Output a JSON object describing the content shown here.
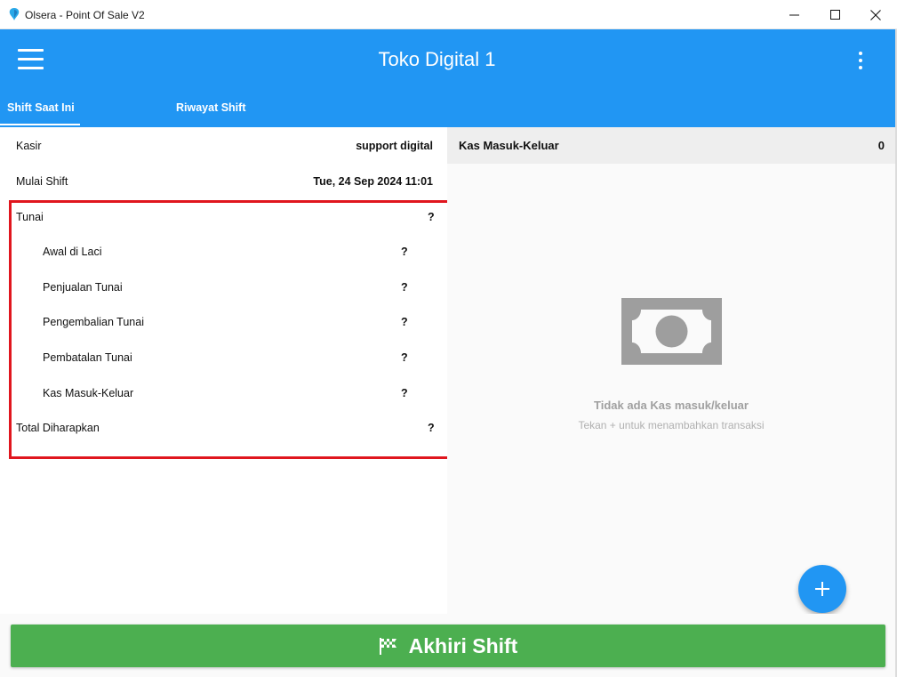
{
  "window": {
    "title": "Olsera - Point Of Sale V2"
  },
  "appbar": {
    "title": "Toko Digital 1",
    "color": "#2196f3"
  },
  "tabs": [
    {
      "label": "Shift Saat Ini",
      "active": true
    },
    {
      "label": "Riwayat Shift",
      "active": false
    }
  ],
  "shift": {
    "cashier_label": "Kasir",
    "cashier_value": "support digital",
    "start_label": "Mulai Shift",
    "start_value": "Tue, 24 Sep 2024 11:01",
    "cash_label": "Tunai",
    "cash_value": "?",
    "details": [
      {
        "label": "Awal di Laci",
        "value": "?"
      },
      {
        "label": "Penjualan Tunai",
        "value": "?"
      },
      {
        "label": "Pengembalian Tunai",
        "value": "?"
      },
      {
        "label": "Pembatalan Tunai",
        "value": "?"
      },
      {
        "label": "Kas Masuk-Keluar",
        "value": "?"
      }
    ],
    "total_label": "Total Diharapkan",
    "total_value": "?"
  },
  "cash_io": {
    "title": "Kas Masuk-Keluar",
    "count": "0",
    "empty_title": "Tidak ada Kas masuk/keluar",
    "empty_subtitle": "Tekan + untuk menambahkan transaksi",
    "empty_icon": "banknote-icon"
  },
  "actions": {
    "end_shift_label": "Akhiri Shift",
    "end_shift_color": "#4caf50",
    "add_icon": "plus-icon"
  },
  "highlight_color": "#e0161e"
}
